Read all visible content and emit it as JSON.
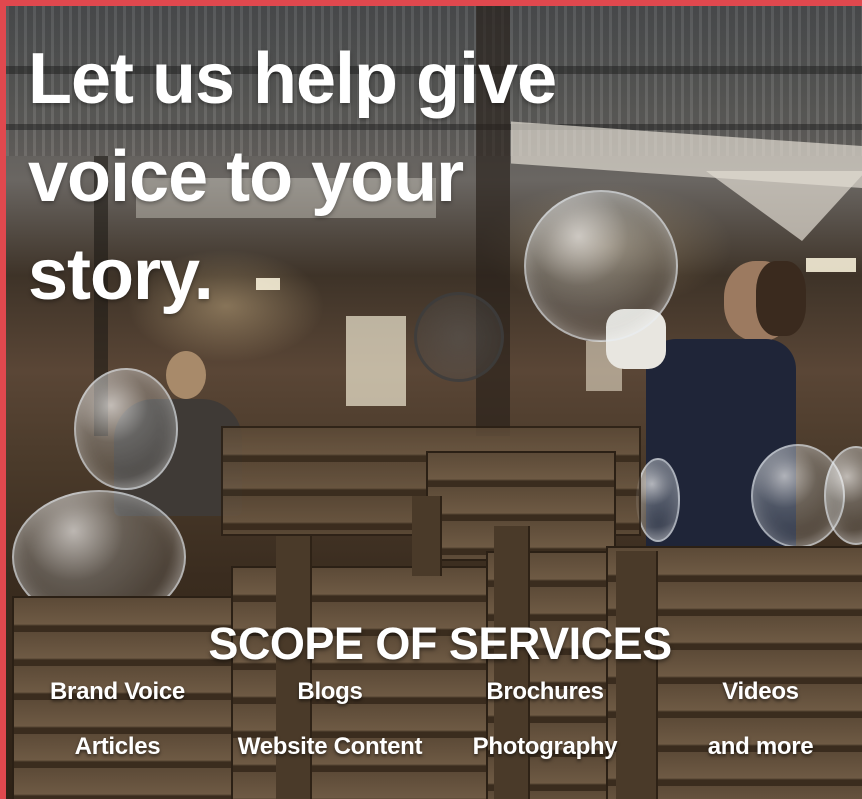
{
  "headline": {
    "line1": "Let us help give",
    "line2": "voice to your",
    "line3": "story."
  },
  "scope": {
    "title": "SCOPE OF SERVICES",
    "services": [
      "Brand Voice",
      "Blogs",
      "Brochures",
      "Videos",
      "Articles",
      "Website Content",
      "Photography",
      "and more"
    ]
  },
  "colors": {
    "border_accent": "#e0484e",
    "text": "#ffffff"
  }
}
